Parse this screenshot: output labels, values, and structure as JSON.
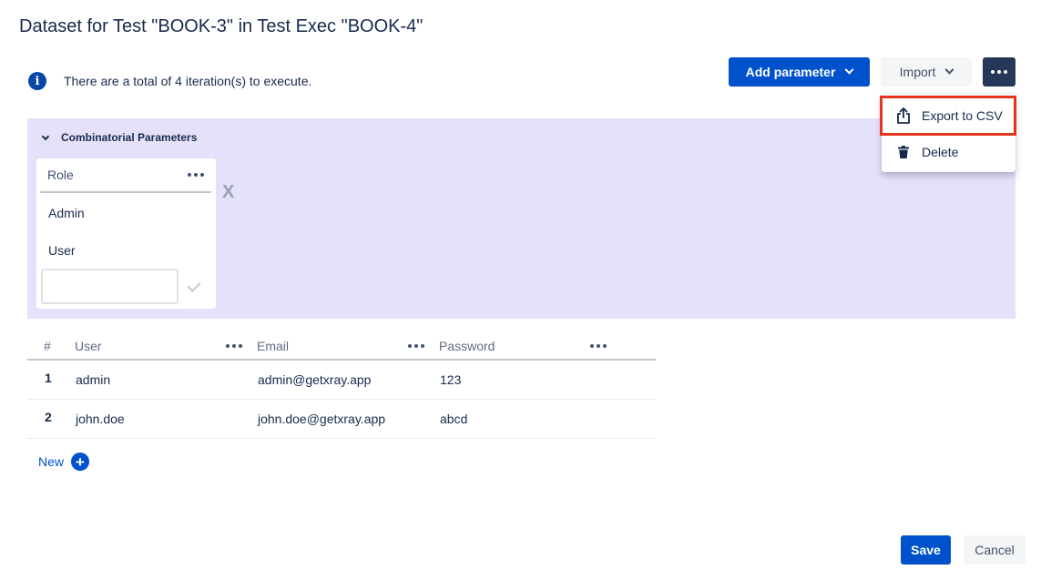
{
  "title": "Dataset for Test \"BOOK-3\" in Test Exec \"BOOK-4\"",
  "info": {
    "icon": "info-icon",
    "text": "There are a total of 4 iteration(s) to execute."
  },
  "toolbar": {
    "add_parameter_label": "Add parameter",
    "import_label": "Import",
    "more_icon": "more-icon"
  },
  "dropdown": {
    "items": [
      {
        "label": "Export to CSV",
        "icon": "export-icon"
      },
      {
        "label": "Delete",
        "icon": "trash-icon"
      }
    ],
    "highlight_color": "#e5341d"
  },
  "combinatorial": {
    "header": "Combinatorial Parameters",
    "parameter": {
      "name": "Role",
      "values": [
        "Admin",
        "User"
      ],
      "input_value": ""
    },
    "remove_label": "X",
    "background": "#e6e1fb"
  },
  "table": {
    "columns": [
      "#",
      "User",
      "Email",
      "Password"
    ],
    "rows": [
      {
        "num": "1",
        "user": "admin",
        "email": "admin@getxray.app",
        "password": "123"
      },
      {
        "num": "2",
        "user": "john.doe",
        "email": "john.doe@getxray.app",
        "password": "abcd"
      }
    ]
  },
  "new_label": "New",
  "footer": {
    "save_label": "Save",
    "cancel_label": "Cancel"
  },
  "colors": {
    "primary": "#0052cc",
    "dark_button": "#253858"
  }
}
